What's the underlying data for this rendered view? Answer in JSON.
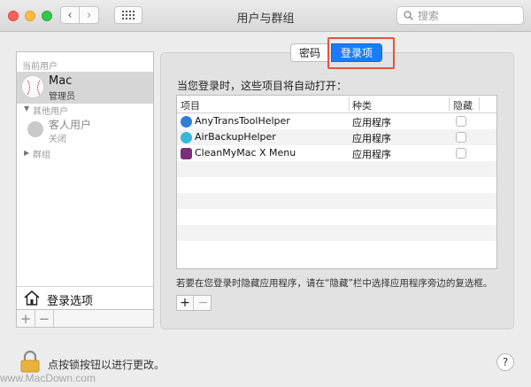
{
  "window": {
    "title": "用户与群组"
  },
  "search": {
    "placeholder": "搜索"
  },
  "sidebar": {
    "current_section": "当前用户",
    "current_user": {
      "name": "Mac",
      "role": "管理员"
    },
    "other_section": "其他用户",
    "guest": {
      "name": "客人用户",
      "state": "关闭"
    },
    "groups": "群组",
    "login_options": "登录选项",
    "add": "+",
    "remove": "−"
  },
  "tabs": {
    "password": "密码",
    "login_items": "登录项"
  },
  "main": {
    "headline": "当您登录时，这些项目将自动打开：",
    "columns": {
      "item": "项目",
      "kind": "种类",
      "hide": "隐藏"
    },
    "rows": [
      {
        "name": "AnyTransToolHelper",
        "kind": "应用程序",
        "hidden": false,
        "icon": "anytrans-icon",
        "color": "#2f7fd6"
      },
      {
        "name": "AirBackupHelper",
        "kind": "应用程序",
        "hidden": false,
        "icon": "airbackup-icon",
        "color": "#35b9d8"
      },
      {
        "name": "CleanMyMac X Menu",
        "kind": "应用程序",
        "hidden": false,
        "icon": "cleanmymac-icon",
        "color": "#7a2e7c"
      }
    ],
    "hint": "若要在您登录时隐藏应用程序，请在“隐藏”栏中选择应用程序旁边的复选框。",
    "add": "+",
    "remove": "−"
  },
  "footer": {
    "lock_text": "点按锁按钮以进行更改。",
    "help": "?"
  },
  "watermark": "www.MacDown.com",
  "colors": {
    "accent": "#1a7df7",
    "highlight": "#e5533d"
  }
}
